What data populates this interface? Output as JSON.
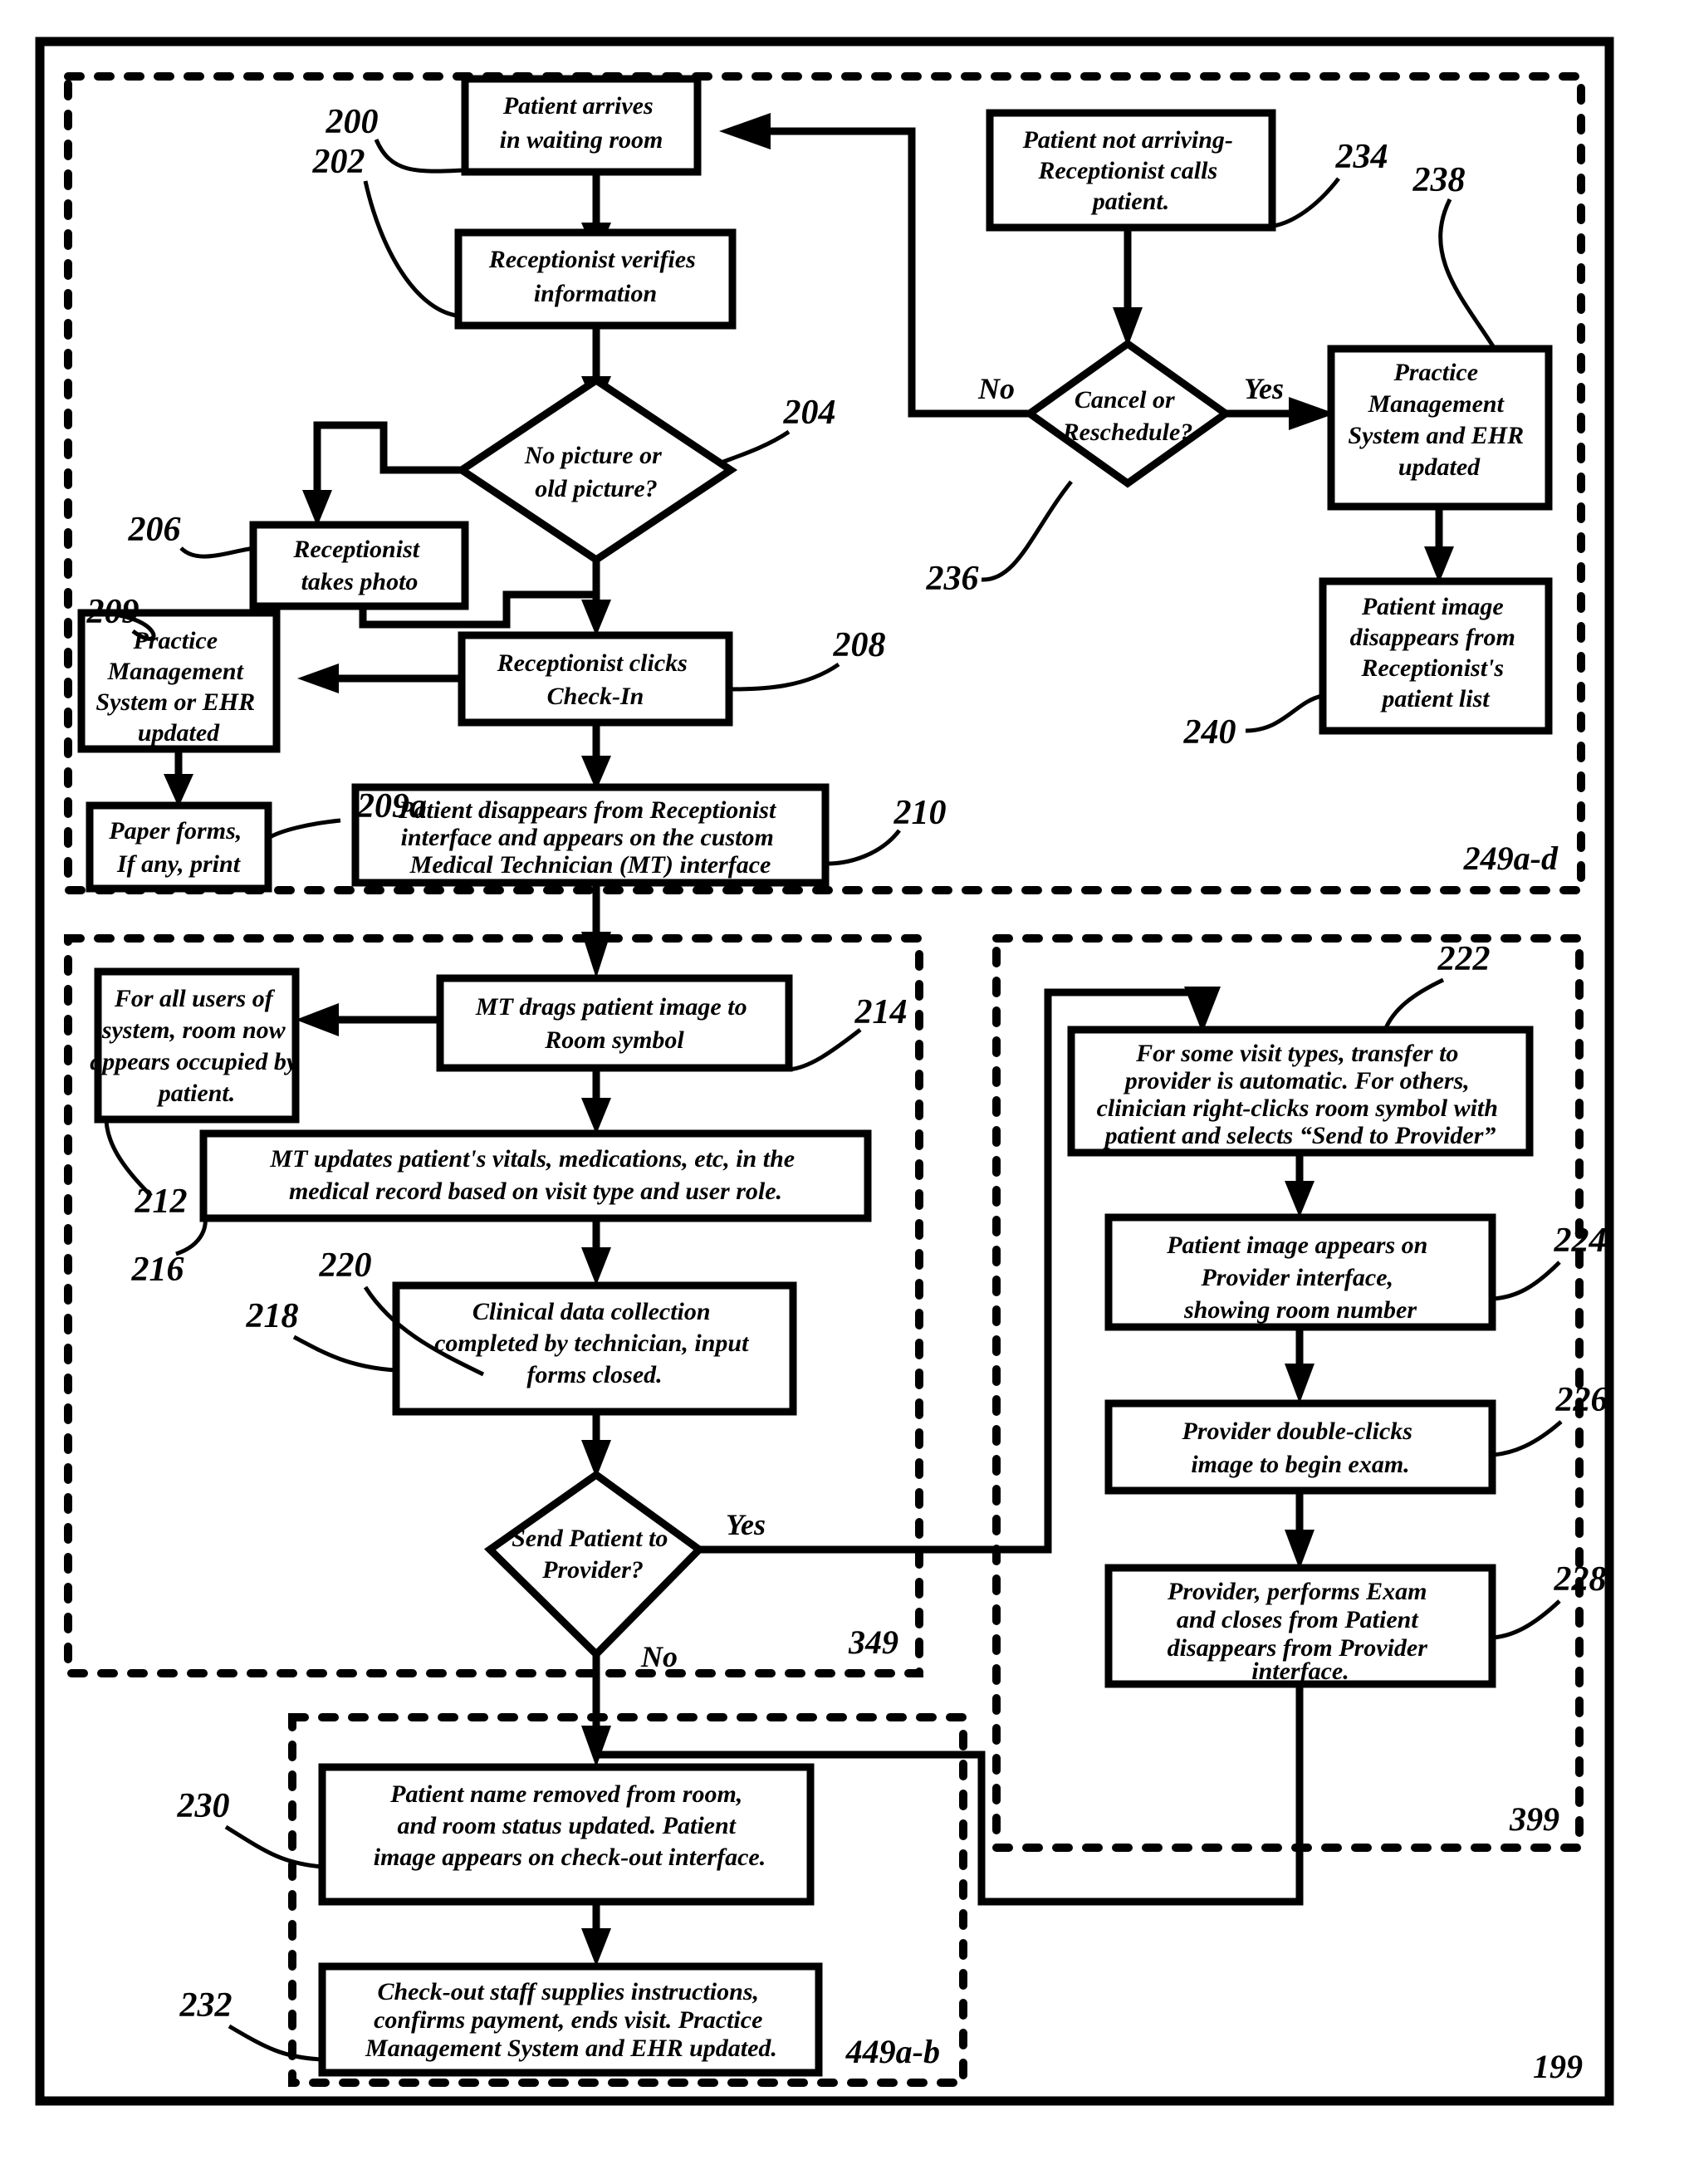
{
  "figure": {
    "outer_label": "199",
    "colors": {
      "ink": "#000000",
      "paper": "#ffffff"
    }
  },
  "sections": [
    {
      "id": "sec-249",
      "label": "249a-d"
    },
    {
      "id": "sec-349",
      "label": "349"
    },
    {
      "id": "sec-399",
      "label": "399"
    },
    {
      "id": "sec-449",
      "label": "449a-b"
    }
  ],
  "nodes": {
    "n200": {
      "ref": "200",
      "shape": "process",
      "lines": [
        "Patient arrives",
        "in waiting room"
      ]
    },
    "n202": {
      "ref": "202",
      "shape": "process",
      "lines": [
        "Receptionist verifies",
        "information"
      ]
    },
    "n204": {
      "ref": "204",
      "shape": "decision",
      "lines": [
        "No picture or",
        "old picture?"
      ]
    },
    "n206": {
      "ref": "206",
      "shape": "process",
      "lines": [
        "Receptionist",
        "takes photo"
      ]
    },
    "n208": {
      "ref": "208",
      "shape": "process",
      "lines": [
        "Receptionist clicks",
        "Check-In"
      ]
    },
    "n209": {
      "ref": "209",
      "shape": "process",
      "lines": [
        "Practice",
        "Management",
        "System or EHR",
        "updated"
      ]
    },
    "n209a": {
      "ref": "209a",
      "shape": "process",
      "lines": [
        "Paper forms,",
        "If any, print"
      ]
    },
    "n210": {
      "ref": "210",
      "shape": "process",
      "lines": [
        "Patient disappears from Receptionist",
        "interface and appears on the custom",
        "Medical Technician (MT) interface"
      ]
    },
    "n212": {
      "ref": "212",
      "shape": "process",
      "lines": [
        "For all users of",
        "system, room now",
        "appears occupied by",
        "patient."
      ]
    },
    "n214": {
      "ref": "214",
      "shape": "process",
      "lines": [
        "MT drags patient image to",
        "Room symbol"
      ]
    },
    "n216": {
      "ref": "216",
      "shape": "process",
      "lines": [
        "MT updates patient's vitals, medications, etc, in the",
        "medical record based on visit type and user role."
      ]
    },
    "n218": {
      "ref": "218",
      "shape": "process",
      "lines": [
        "Clinical data collection",
        "completed by technician, input",
        "forms closed."
      ]
    },
    "n220": {
      "ref": "220",
      "shape": "decision",
      "lines": [
        "Send Patient to",
        "Provider?"
      ]
    },
    "n222": {
      "ref": "222",
      "shape": "process",
      "lines": [
        "For some visit types, transfer to",
        "provider is automatic. For others,",
        "clinician right-clicks room symbol with",
        "patient and selects “Send to Provider”"
      ]
    },
    "n224": {
      "ref": "224",
      "shape": "process",
      "lines": [
        "Patient image appears on",
        "Provider interface,",
        "showing room number"
      ]
    },
    "n226": {
      "ref": "226",
      "shape": "process",
      "lines": [
        "Provider double-clicks",
        "image to begin exam."
      ]
    },
    "n228": {
      "ref": "228",
      "shape": "process",
      "lines": [
        "Provider, performs Exam",
        "and closes from Patient",
        "disappears from Provider",
        "interface."
      ]
    },
    "n230": {
      "ref": "230",
      "shape": "process",
      "lines": [
        "Patient name removed from room,",
        "and room status updated. Patient",
        "image appears on check-out interface."
      ]
    },
    "n232": {
      "ref": "232",
      "shape": "process",
      "lines": [
        "Check-out staff supplies instructions,",
        "confirms payment, ends visit. Practice",
        "Management System and EHR updated."
      ]
    },
    "n234": {
      "ref": "234",
      "shape": "process",
      "lines": [
        "Patient not arriving-",
        "Receptionist calls",
        "patient."
      ]
    },
    "n236": {
      "ref": "236",
      "shape": "decision",
      "lines": [
        "Cancel or",
        "Reschedule?"
      ]
    },
    "n238": {
      "ref": "238",
      "shape": "process",
      "lines": [
        "Practice",
        "Management",
        "System and EHR",
        "updated"
      ]
    },
    "n240": {
      "ref": "240",
      "shape": "process",
      "lines": [
        "Patient image",
        "disappears from",
        "Receptionist's",
        "patient list"
      ]
    }
  },
  "edge_labels": {
    "e236_no": "No",
    "e236_yes": "Yes",
    "e220_yes": "Yes",
    "e220_no": "No"
  }
}
